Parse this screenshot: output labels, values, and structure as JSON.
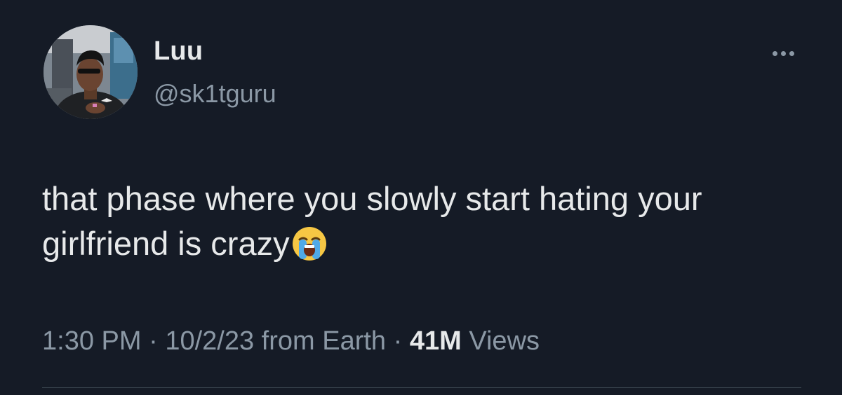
{
  "tweet": {
    "author": {
      "display_name": "Luu",
      "handle": "@sk1tguru",
      "avatar_icon": "profile-photo"
    },
    "more_icon": "more-horizontal-icon",
    "text": "that phase where you slowly start hating your girlfriend is crazy",
    "emoji": "loudly-crying-face",
    "meta": {
      "time": "1:30 PM",
      "separator": "·",
      "date": "10/2/23",
      "source": "from Earth",
      "views_count": "41M",
      "views_label": "Views"
    }
  },
  "colors": {
    "background": "#151b26",
    "primary_text": "#e7e9ea",
    "secondary_text": "#8b98a5",
    "divider": "#38444d"
  }
}
